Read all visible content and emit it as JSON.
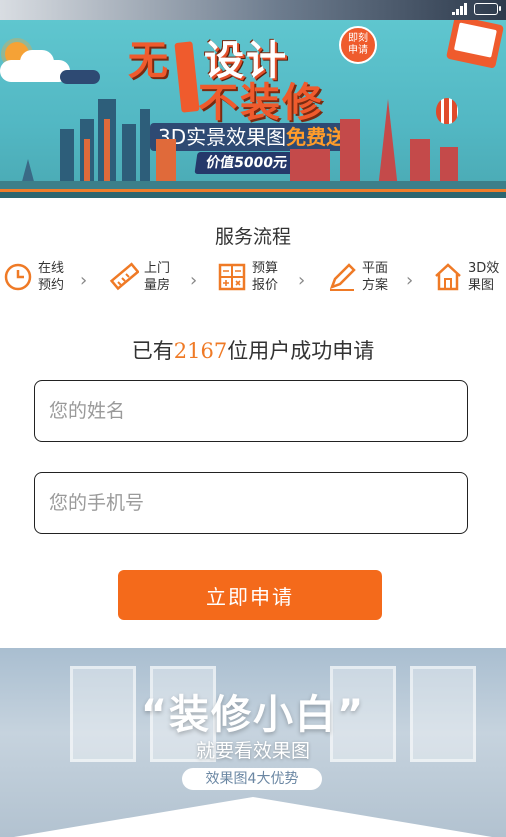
{
  "banner": {
    "headline_wu": "无",
    "headline_line1": "设计",
    "headline_line2": "不装修",
    "badge": "申请",
    "badge2": "即刻",
    "promo_text": "3D实景效果图",
    "promo_free": "免费送",
    "value_tag": "价值5000元"
  },
  "flow": {
    "title": "服务流程",
    "steps": [
      {
        "line1": "在线",
        "line2": "预约",
        "icon": "clock-icon"
      },
      {
        "line1": "上门",
        "line2": "量房",
        "icon": "ruler-icon"
      },
      {
        "line1": "预算",
        "line2": "报价",
        "icon": "calculator-icon"
      },
      {
        "line1": "平面",
        "line2": "方案",
        "icon": "pencil-icon"
      },
      {
        "line1": "3D效",
        "line2": "果图",
        "icon": "house-icon"
      }
    ]
  },
  "counter": {
    "prefix": "已有",
    "count": "2167",
    "suffix": "位用户成功申请"
  },
  "form": {
    "name_placeholder": "您的姓名",
    "phone_placeholder": "您的手机号",
    "submit_label": "立即申请"
  },
  "bottom_banner": {
    "headline": "“装修小白”",
    "subline": "就要看效果图",
    "pill": "效果图4大优势"
  },
  "colors": {
    "accent": "#f46a1b",
    "banner_bg": "#5fc6cf"
  }
}
